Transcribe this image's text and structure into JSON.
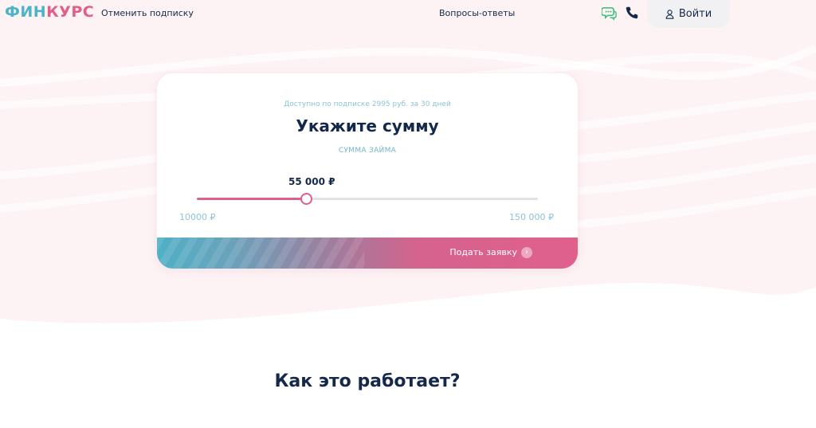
{
  "header": {
    "logo_part1": "ФИН",
    "logo_part2": "КУРС",
    "cancel_subscription": "Отменить подписку",
    "faq": "Вопросы-ответы",
    "login": "Войти",
    "icons": {
      "chat": "chat-bubble-icon",
      "phone": "phone-icon",
      "user": "user-icon"
    }
  },
  "loan_form": {
    "subscription_note": "Доступно по подписке 2995 руб. за 30 дней",
    "title": "Укажите сумму",
    "amount_label": "СУММА ЗАЙМА",
    "current_value": "55 000 ₽",
    "min_label": "10000 ₽",
    "max_label": "150 000 ₽",
    "slider": {
      "min": 10000,
      "max": 150000,
      "value": 55000
    },
    "submit_label": "Подать заявку"
  },
  "how_it_works": {
    "title": "Как это работает?"
  },
  "colors": {
    "brand_blue": "#4db3c6",
    "brand_pink": "#e0608c",
    "text_dark": "#14294a",
    "hero_bg": "#fdf2f4"
  }
}
